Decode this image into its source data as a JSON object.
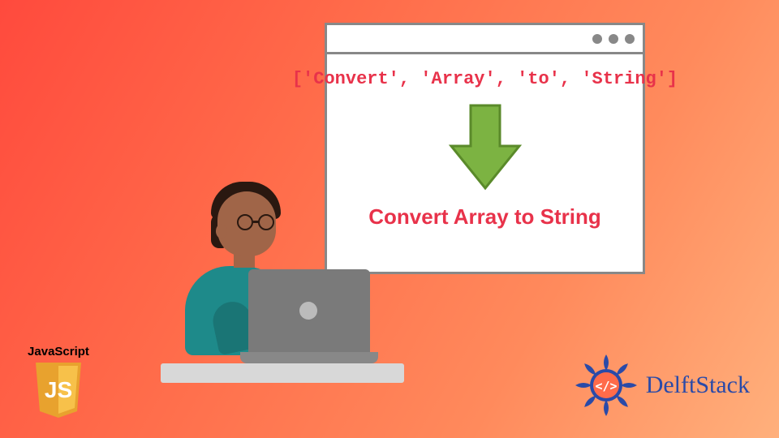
{
  "browser": {
    "array_literal": "['Convert', 'Array', 'to', 'String']",
    "result": "Convert Array to String"
  },
  "js_badge": {
    "label": "JavaScript",
    "abbrev": "JS"
  },
  "brand": {
    "name": "DelftStack"
  },
  "icons": {
    "arrow_color": "#7cb342"
  }
}
